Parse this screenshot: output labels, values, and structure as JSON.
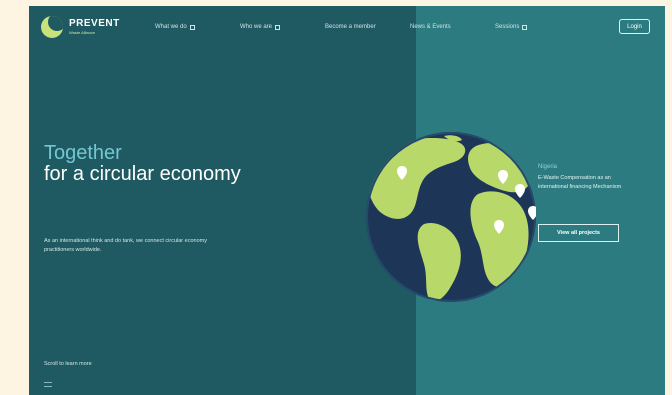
{
  "brand": {
    "name": "PREVENT",
    "subtitle": "Waste Alliance"
  },
  "nav": {
    "items": [
      {
        "label": "What we do"
      },
      {
        "label": "Who we are"
      },
      {
        "label": "Become a member"
      },
      {
        "label": "News & Events"
      },
      {
        "label": "Sessions"
      }
    ],
    "login_label": "Login"
  },
  "hero": {
    "title_accent": "Together",
    "title_main": "for a circular economy",
    "intro": "As an international think and do tank, we connect circular economy practitioners worldwide."
  },
  "scroll_label": "Scroll to learn more",
  "project": {
    "country": "Nigeria",
    "description": "E-Waste Compensation as an international financing Mechanism",
    "button_label": "View all projects"
  },
  "colors": {
    "background": "#1f5a63",
    "panel": "#2c7b80",
    "accent": "#74c7d0",
    "globe_land": "#b9d86a",
    "globe_ocean": "#1d3557"
  },
  "icons": {
    "menu_indicator": "chevron-box-icon",
    "map_pin": "map-pin-icon"
  }
}
